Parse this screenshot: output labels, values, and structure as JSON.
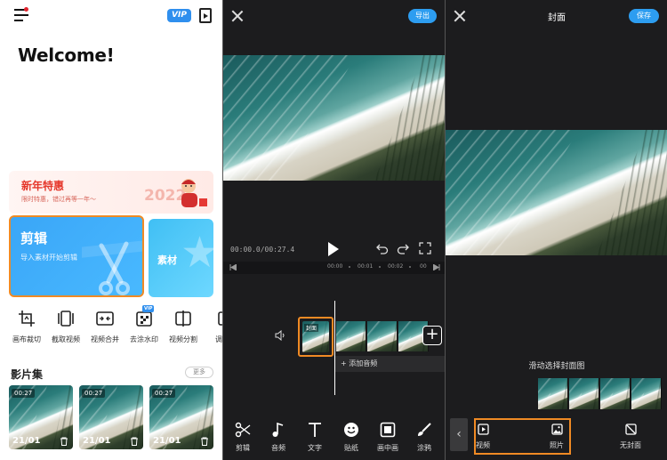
{
  "home": {
    "welcome": "Welcome!",
    "vip_badge": "VIP",
    "promo": {
      "title": "新年特惠",
      "subtitle": "限时特惠，错过再等一年～",
      "art_text": "2022"
    },
    "edit_card": {
      "title": "剪辑",
      "subtitle": "导入素材开始剪辑"
    },
    "material_card": {
      "title": "素材"
    },
    "tools": [
      {
        "label": "画布裁切",
        "icon": "crop-icon"
      },
      {
        "label": "截取视频",
        "icon": "trim-icon"
      },
      {
        "label": "视频合并",
        "icon": "merge-icon"
      },
      {
        "label": "去涂水印",
        "icon": "watermark-icon",
        "badge": "VIP"
      },
      {
        "label": "视频分割",
        "icon": "split-icon"
      },
      {
        "label": "调整",
        "icon": "adjust-icon"
      }
    ],
    "films_section": {
      "title": "影片集",
      "more": "更多",
      "items": [
        {
          "duration": "00:27",
          "date": "21/01"
        },
        {
          "duration": "00:27",
          "date": "21/01"
        },
        {
          "duration": "00:27",
          "date": "21/01"
        }
      ]
    }
  },
  "editor": {
    "export": "导出",
    "timecode": "00:00.0/00:27.4",
    "ruler": {
      "marks": [
        "00:00",
        "00:01",
        "00:02",
        "00"
      ]
    },
    "cover_label": "封面",
    "add_audio": "添加音频",
    "bottom_tools": [
      {
        "label": "剪辑",
        "icon": "scissors-icon"
      },
      {
        "label": "音频",
        "icon": "music-note-icon"
      },
      {
        "label": "文字",
        "icon": "text-icon"
      },
      {
        "label": "贴纸",
        "icon": "sticker-icon"
      },
      {
        "label": "画中画",
        "icon": "pip-icon"
      },
      {
        "label": "涂鸦",
        "icon": "brush-icon"
      }
    ]
  },
  "cover": {
    "title": "封面",
    "save": "保存",
    "hint": "滑动选择封面图",
    "sources": [
      {
        "label": "视频",
        "icon": "video-source-icon"
      },
      {
        "label": "照片",
        "icon": "photo-source-icon"
      },
      {
        "label": "无封面",
        "icon": "no-cover-icon"
      }
    ]
  },
  "colors": {
    "accent_blue": "#2d9df0",
    "highlight_orange": "#f08a24",
    "promo_red": "#e5372b",
    "dark_bg": "#1c1c1e"
  }
}
